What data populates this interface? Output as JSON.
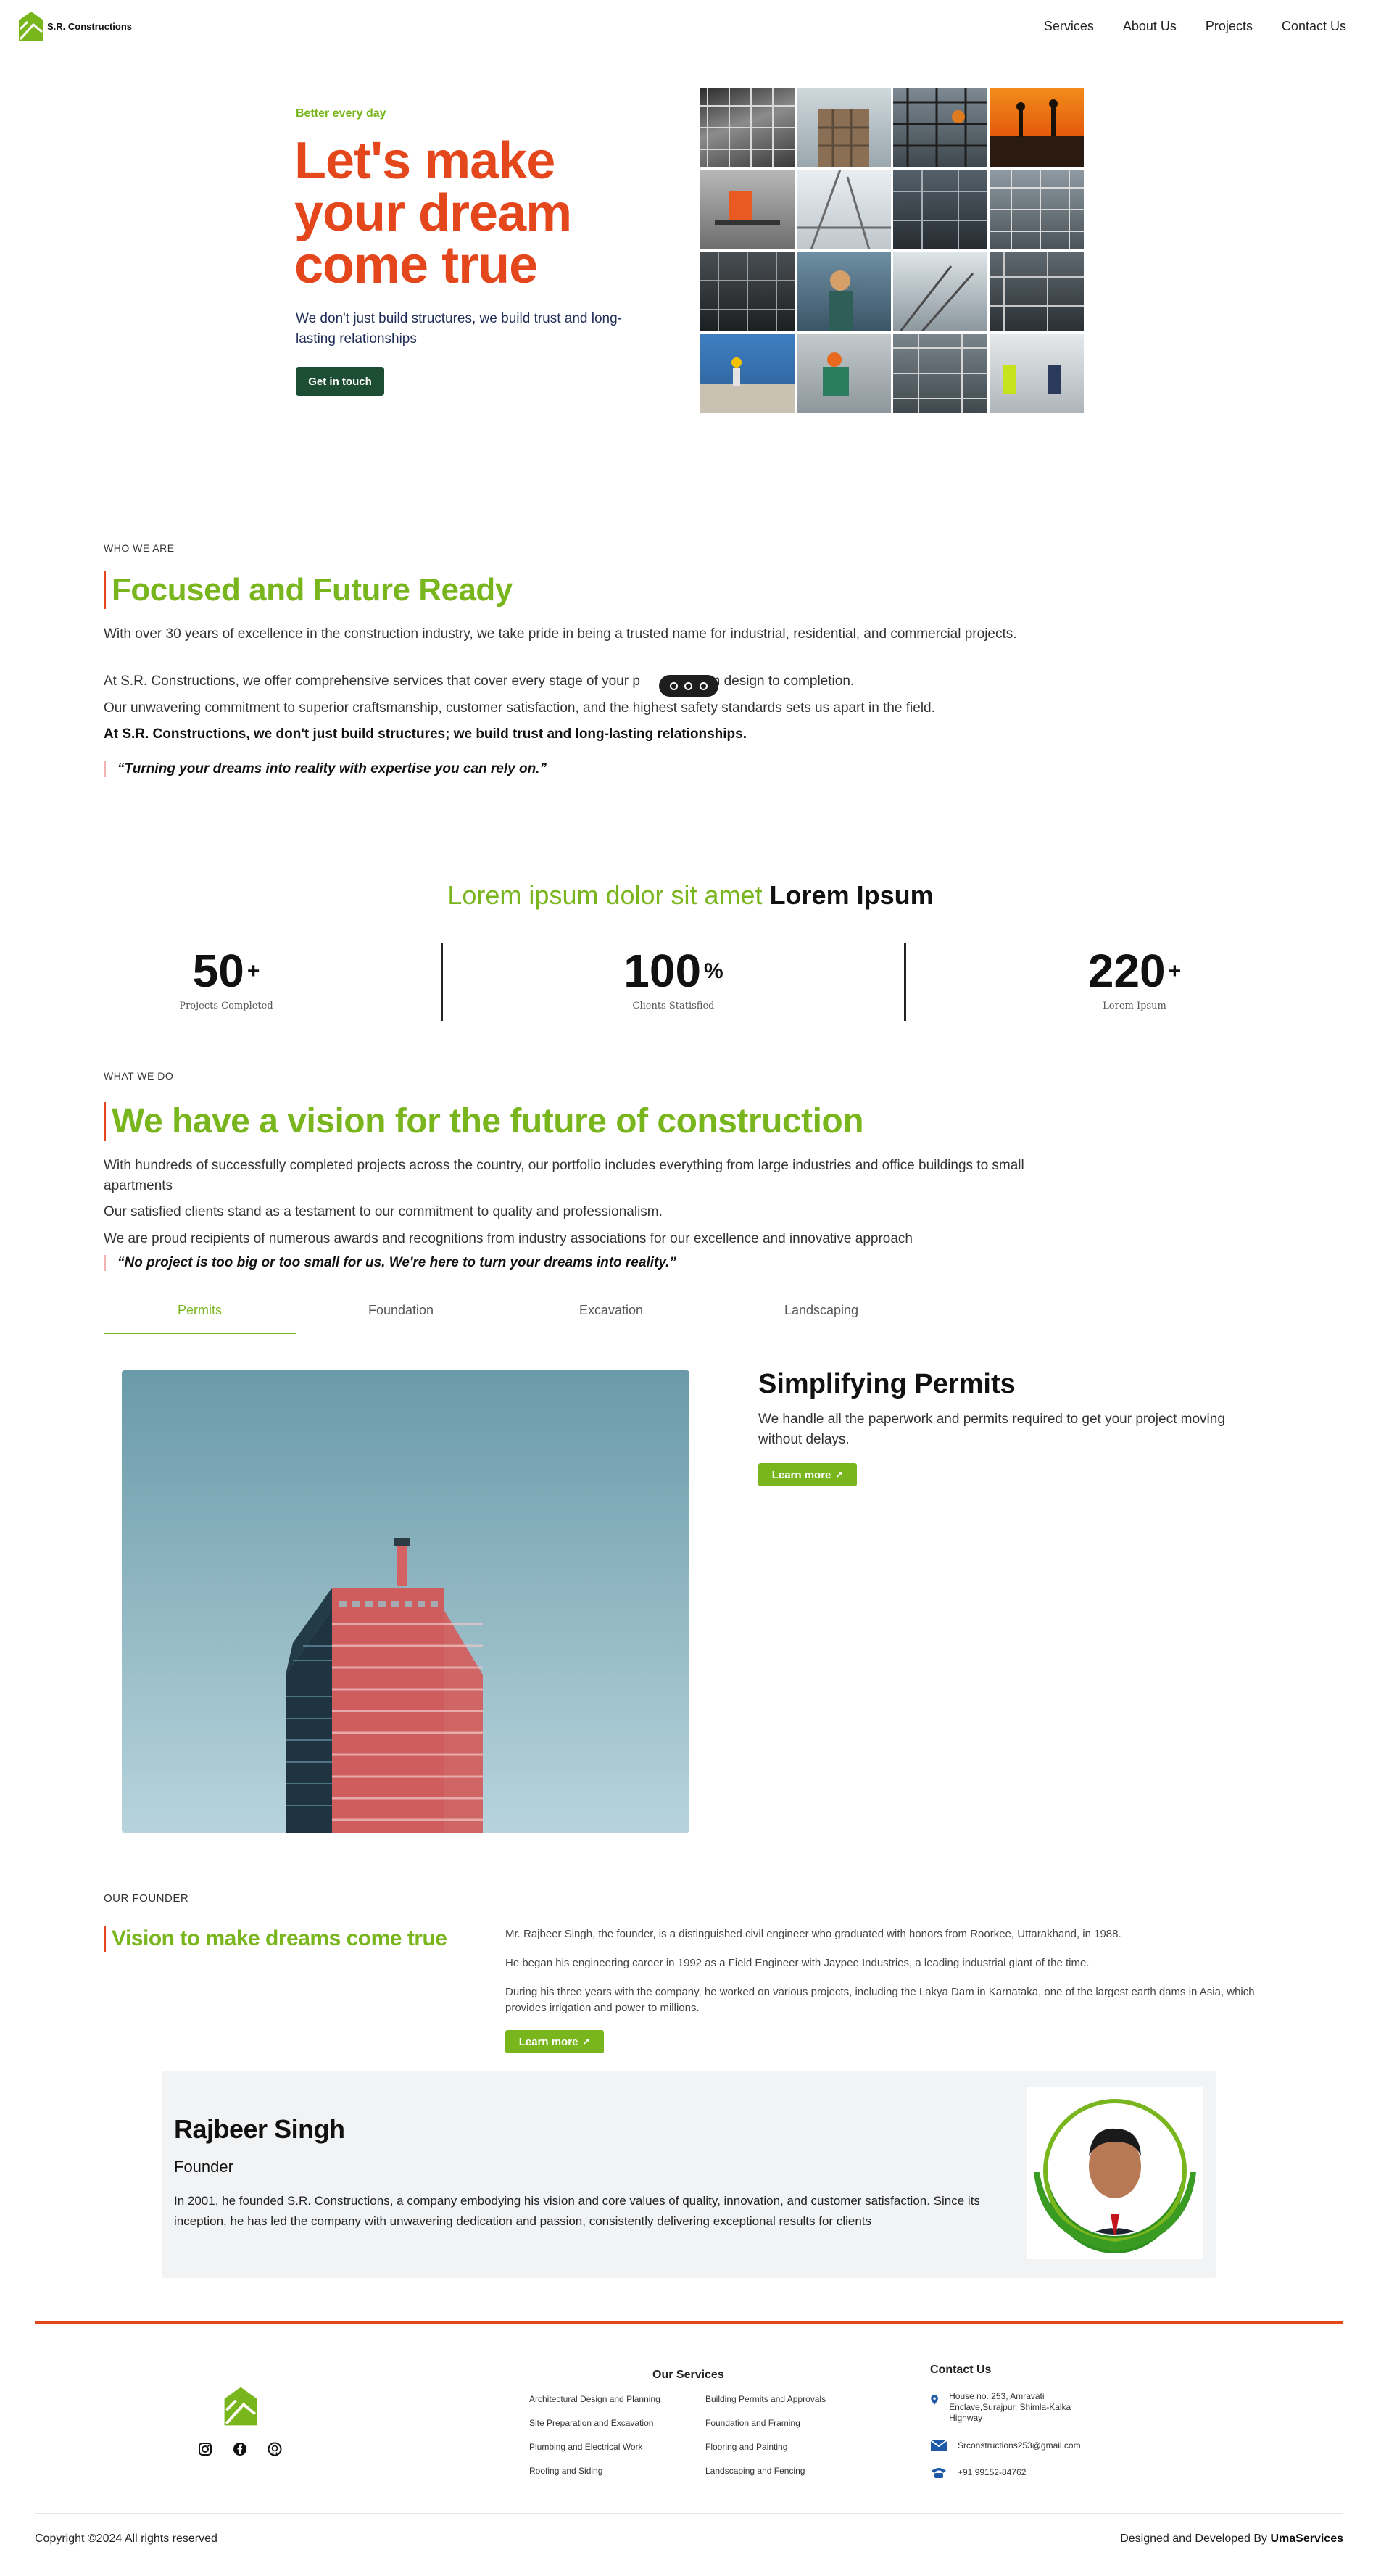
{
  "brand": {
    "name": "S.R. Constructions",
    "accent_green": "#79b51c",
    "accent_orange": "#e4471c",
    "dark_green": "#1d4d33"
  },
  "nav": {
    "items": [
      {
        "label": "Services"
      },
      {
        "label": "About Us"
      },
      {
        "label": "Projects"
      },
      {
        "label": "Contact Us"
      }
    ]
  },
  "hero": {
    "eyebrow": "Better every day",
    "title": "Let's make your dream come true",
    "subtitle": "We don't just build structures, we build trust and long-lasting relationships",
    "cta": "Get in touch"
  },
  "about": {
    "eyebrow": "WHO WE ARE",
    "title": "Focused and Future Ready",
    "p1": "With over 30 years of excellence in the construction industry, we take pride in being a trusted name for industrial, residential, and commercial projects.",
    "p2a": "At S.R. Constructions, we offer comprehensive services that cover every stage of your p",
    "p2b": "om design to completion.",
    "p3": "Our unwavering commitment to superior craftsmanship, customer satisfaction, and the highest safety standards sets us apart in the field.",
    "p4": "At S.R. Constructions, we don't just build structures; we build trust and long-lasting relationships.",
    "quote": "“Turning your dreams into reality with expertise you can rely on.”"
  },
  "stats": {
    "heading_light": "Lorem ipsum dolor sit amet",
    "heading_bold": "Lorem Ipsum",
    "items": [
      {
        "value": "50",
        "suffix": "+",
        "label": "Projects Completed"
      },
      {
        "value": "100",
        "suffix": "%",
        "label": "Clients Statisfied"
      },
      {
        "value": "220",
        "suffix": "+",
        "label": "Lorem Ipsum"
      }
    ]
  },
  "vision": {
    "eyebrow": "WHAT WE DO",
    "title": "We have a vision for the future of construction",
    "p1": "With hundreds of successfully completed projects across the country, our portfolio includes everything from large industries and office buildings to small apartments",
    "p2": "Our satisfied clients stand as a testament to our commitment to quality and professionalism.",
    "p3": "We are proud recipients of numerous awards and recognitions from industry associations for our excellence and innovative approach",
    "quote": "“No project is too big or too small for us. We're here to turn your dreams into reality.”"
  },
  "tabs": {
    "items": [
      {
        "label": "Permits"
      },
      {
        "label": "Foundation"
      },
      {
        "label": "Excavation"
      },
      {
        "label": "Landscaping"
      }
    ],
    "active_index": 0,
    "panel_title": "Simplifying Permits",
    "panel_text": "We handle all the paperwork and permits required to get your project moving without delays.",
    "panel_cta": "Learn more"
  },
  "founder": {
    "eyebrow": "OUR FOUNDER",
    "title": "Vision to make dreams come true",
    "p1": "Mr. Rajbeer Singh, the founder, is a distinguished civil engineer who graduated with honors from Roorkee, Uttarakhand, in 1988.",
    "p2": "He began his engineering career in 1992 as a Field Engineer with Jaypee Industries, a leading industrial giant of the time.",
    "p3": "During his three years with the company, he worked on various projects, including the Lakya Dam in Karnataka, one of the largest earth dams in Asia, which provides irrigation and power to millions.",
    "cta": "Learn more",
    "card_name": "Rajbeer Singh",
    "card_role": "Founder",
    "card_text": "In 2001, he founded S.R. Constructions, a company embodying his vision and core values of quality, innovation, and customer satisfaction. Since its inception, he has led the company with unwavering dedication and passion, consistently delivering exceptional results for clients"
  },
  "footer": {
    "services_heading": "Our Services",
    "services_col1": [
      "Architectural Design and Planning",
      "Site Preparation and Excavation",
      "Plumbing and Electrical Work",
      "Roofing and Siding"
    ],
    "services_col2": [
      "Building Permits and Approvals",
      "Foundation and Framing",
      "Flooring and Painting",
      "Landscaping and Fencing"
    ],
    "contact_heading": "Contact Us",
    "address": "House no. 253, Amravati Enclave,Surajpur, Shimla-Kalka Highway",
    "email": "Srconstructions253@gmail.com",
    "phone": "+91 99152-84762",
    "social_icons": [
      "instagram-icon",
      "facebook-icon",
      "github-icon"
    ],
    "copyright": "Copyright ©2024 All rights reserved",
    "credit_prefix": "Designed and Developed By",
    "credit_link": "UmaServices"
  }
}
